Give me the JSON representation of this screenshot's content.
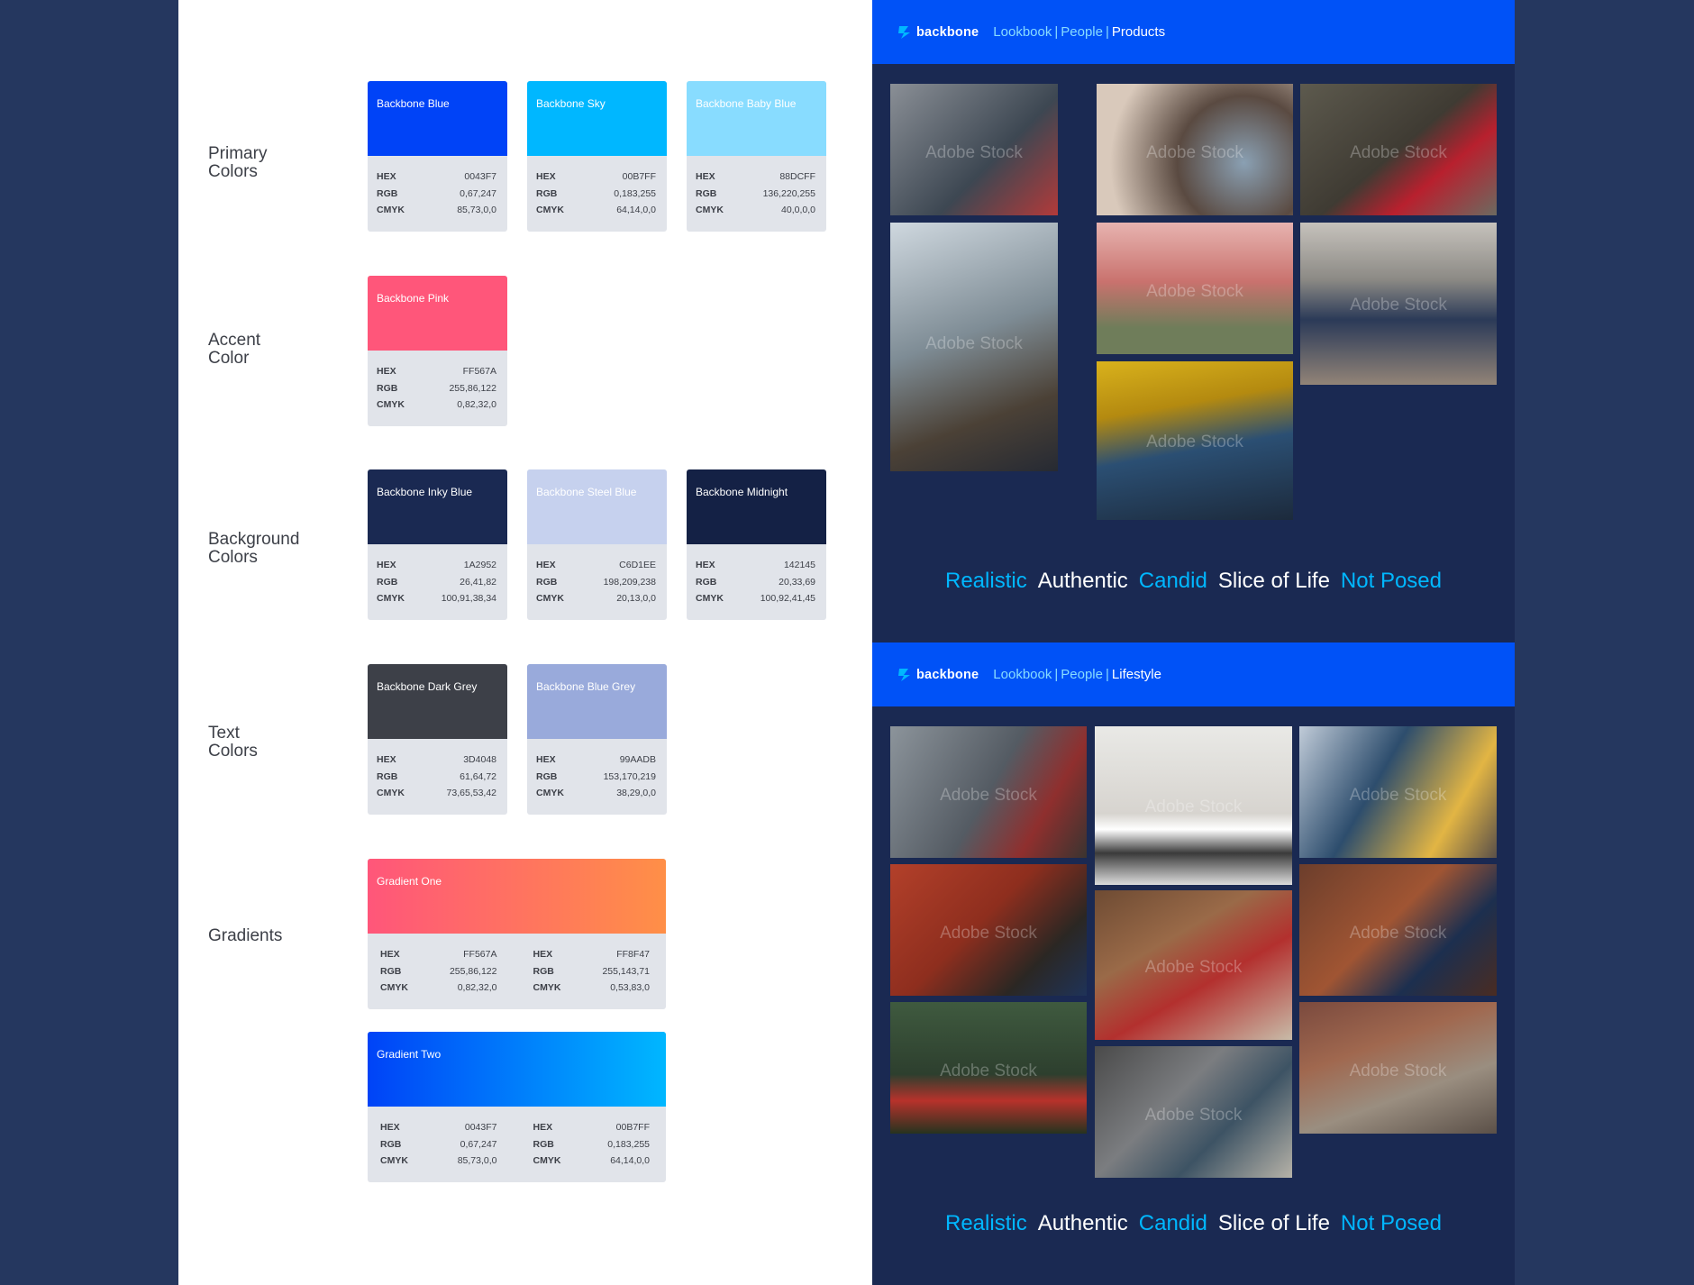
{
  "palette": {
    "sections": {
      "primary": "Primary\nColors",
      "accent": "Accent\nColor",
      "background": "Background\nColors",
      "text": "Text\nColors",
      "gradients": "Gradients"
    },
    "swatches": {
      "blue": {
        "name": "Backbone Blue",
        "color": "#0043f7",
        "text_color": "#ffffff",
        "hex": "0043F7",
        "rgb": "0,67,247",
        "cmyk": "85,73,0,0"
      },
      "sky": {
        "name": "Backbone Sky",
        "color": "#00b7ff",
        "text_color": "#ffffff",
        "hex": "00B7FF",
        "rgb": "0,183,255",
        "cmyk": "64,14,0,0"
      },
      "babyblue": {
        "name": "Backbone Baby Blue",
        "color": "#88dcff",
        "text_color": "#ffffff",
        "hex": "88DCFF",
        "rgb": "136,220,255",
        "cmyk": "40,0,0,0"
      },
      "pink": {
        "name": "Backbone Pink",
        "color": "#ff567a",
        "text_color": "#ffffff",
        "hex": "FF567A",
        "rgb": "255,86,122",
        "cmyk": "0,82,32,0"
      },
      "inky": {
        "name": "Backbone Inky Blue",
        "color": "#1a2952",
        "text_color": "#ffffff",
        "hex": "1A2952",
        "rgb": "26,41,82",
        "cmyk": "100,91,38,34"
      },
      "steel": {
        "name": "Backbone Steel Blue",
        "color": "#c6d1ee",
        "text_color": "#ffffff",
        "hex": "C6D1EE",
        "rgb": "198,209,238",
        "cmyk": "20,13,0,0"
      },
      "midnight": {
        "name": "Backbone Midnight",
        "color": "#142145",
        "text_color": "#ffffff",
        "hex": "142145",
        "rgb": "20,33,69",
        "cmyk": "100,92,41,45"
      },
      "darkgrey": {
        "name": "Backbone Dark Grey",
        "color": "#3d4048",
        "text_color": "#ffffff",
        "hex": "3D4048",
        "rgb": "61,64,72",
        "cmyk": "73,65,53,42"
      },
      "bluegrey": {
        "name": "Backbone Blue Grey",
        "color": "#99aadb",
        "text_color": "#ffffff",
        "hex": "99AADB",
        "rgb": "153,170,219",
        "cmyk": "38,29,0,0"
      }
    },
    "gradients": {
      "one": {
        "name": "Gradient One",
        "from": "#ff567a",
        "to": "#ff8f47",
        "a": {
          "hex": "FF567A",
          "rgb": "255,86,122",
          "cmyk": "0,82,32,0"
        },
        "b": {
          "hex": "FF8F47",
          "rgb": "255,143,71",
          "cmyk": "0,53,83,0"
        }
      },
      "two": {
        "name": "Gradient Two",
        "from": "#0043f7",
        "to": "#00b7ff",
        "a": {
          "hex": "0043F7",
          "rgb": "0,67,247",
          "cmyk": "85,73,0,0"
        },
        "b": {
          "hex": "00B7FF",
          "rgb": "0,183,255",
          "cmyk": "64,14,0,0"
        }
      }
    },
    "field_labels": {
      "hex": "HEX",
      "rgb": "RGB",
      "cmyk": "CMYK"
    }
  },
  "lookbook": {
    "brand": "backbone",
    "crumb_lookbook": "Lookbook",
    "crumb_people": "People",
    "crumb_sep": "|",
    "watermark": "Adobe Stock",
    "products_title": "Products",
    "lifestyle_title": "Lifestyle",
    "tags": [
      "Realistic",
      "Authentic",
      "Candid",
      "Slice of Life",
      "Not Posed"
    ]
  }
}
